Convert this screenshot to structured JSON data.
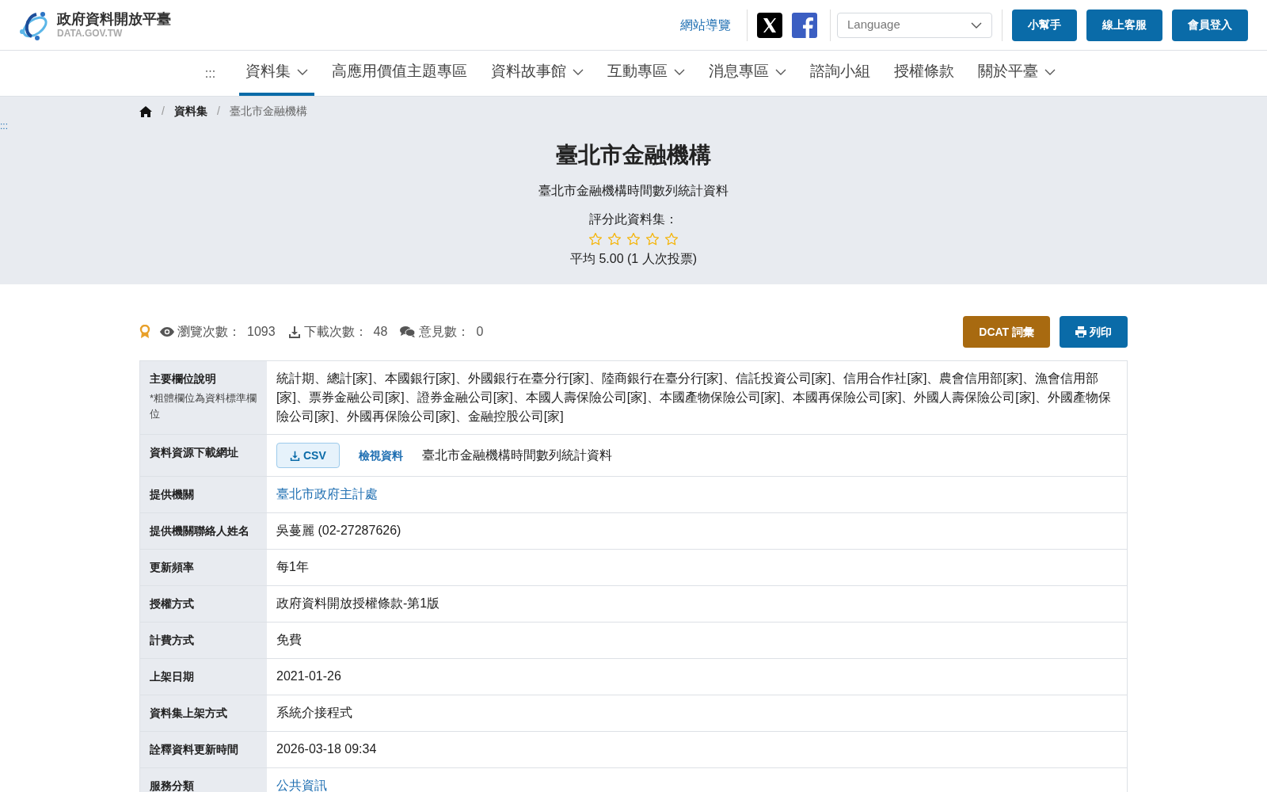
{
  "header": {
    "logo_title": "政府資料開放平臺",
    "logo_subtitle": "DATA.GOV.TW",
    "sitemap_link": "網站導覽",
    "language_select": {
      "placeholder": "Language"
    },
    "buttons": [
      "小幫手",
      "線上客服",
      "會員登入"
    ]
  },
  "nav": {
    "skip_marker": ":::",
    "items": [
      {
        "label": "資料集",
        "selected": true,
        "dropdown": true
      },
      {
        "label": "高應用價值主題專區",
        "selected": false,
        "dropdown": false
      },
      {
        "label": "資料故事館",
        "selected": false,
        "dropdown": true
      },
      {
        "label": "互動專區",
        "selected": false,
        "dropdown": true
      },
      {
        "label": "消息專區",
        "selected": false,
        "dropdown": true
      },
      {
        "label": "諮詢小組",
        "selected": false,
        "dropdown": false
      },
      {
        "label": "授權條款",
        "selected": false,
        "dropdown": false
      },
      {
        "label": "關於平臺",
        "selected": false,
        "dropdown": true
      }
    ]
  },
  "breadcrumb": {
    "separator": "/",
    "items": [
      "資料集",
      "臺北市金融機構"
    ]
  },
  "side_marker": ":::",
  "hero": {
    "title": "臺北市金融機構",
    "subtitle": "臺北市金融機構時間數列統計資料",
    "rating_label": "評分此資料集：",
    "stars": 0,
    "average": "平均 5.00 (1 人次投票)"
  },
  "stats": [
    {
      "kind": "views",
      "label": "瀏覽次數：",
      "value": "1093"
    },
    {
      "kind": "downloads",
      "label": "下載次數：",
      "value": "48"
    },
    {
      "kind": "comments",
      "label": "意見數：",
      "value": "0"
    }
  ],
  "actions": {
    "dcat_button": "DCAT 詞彙",
    "print_button": "列印"
  },
  "table": {
    "rows": [
      {
        "kind": "text",
        "label": "主要欄位說明",
        "note": "*粗體欄位為資料標準欄位",
        "value": "統計期、總計[家]、本國銀行[家]、外國銀行在臺分行[家]、陸商銀行在臺分行[家]、信託投資公司[家]、信用合作社[家]、農會信用部[家]、漁會信用部[家]、票券金融公司[家]、證券金融公司[家]、本國人壽保險公司[家]、本國產物保險公司[家]、本國再保險公司[家]、外國人壽保險公司[家]、外國產物保險公司[家]、外國再保險公司[家]、金融控股公司[家]"
      },
      {
        "kind": "download",
        "label": "資料資源下載網址",
        "format": "CSV",
        "view_link": "檢視資料",
        "value": "臺北市金融機構時間數列統計資料"
      },
      {
        "kind": "link",
        "label": "提供機關",
        "value": "臺北市政府主計處"
      },
      {
        "kind": "text",
        "label": "提供機關聯絡人姓名",
        "value": "吳蔓麗 (02-27287626)"
      },
      {
        "kind": "text",
        "label": "更新頻率",
        "value": "每1年"
      },
      {
        "kind": "text",
        "label": "授權方式",
        "value": "政府資料開放授權條款-第1版"
      },
      {
        "kind": "text",
        "label": "計費方式",
        "value": "免費"
      },
      {
        "kind": "text",
        "label": "上架日期",
        "value": "2021-01-26"
      },
      {
        "kind": "text",
        "label": "資料集上架方式",
        "value": "系統介接程式"
      },
      {
        "kind": "text",
        "label": "詮釋資料更新時間",
        "value": "2026-03-18 09:34"
      },
      {
        "kind": "link",
        "label": "服務分類",
        "value": "公共資訊"
      }
    ]
  }
}
